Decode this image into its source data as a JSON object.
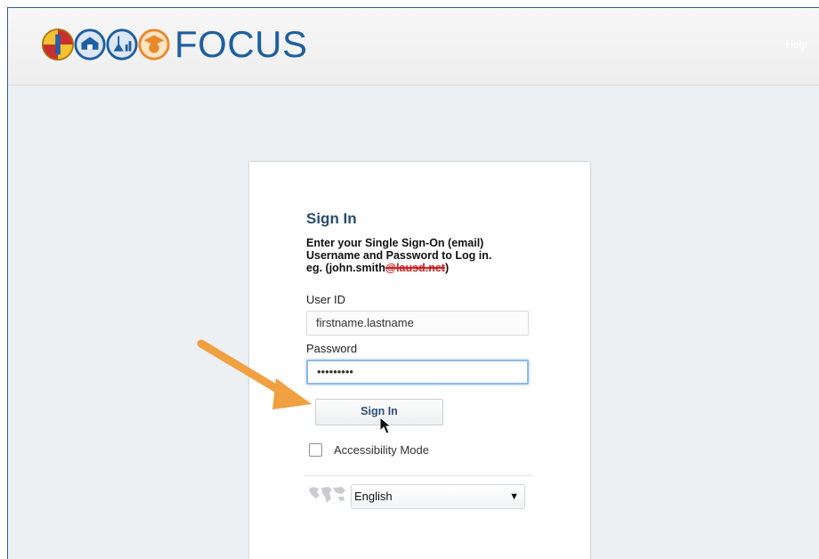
{
  "header": {
    "brand": "FOCUS",
    "help_label": "Help",
    "logo_icons": [
      "lausd-seal-icon",
      "school-building-icon",
      "lab-icon",
      "graduate-icon"
    ]
  },
  "login": {
    "title": "Sign In",
    "instructions_line1": "Enter your Single Sign-On (email)",
    "instructions_line2": "Username and Password to Log in.",
    "instructions_prefix": "eg. (john.smith",
    "instructions_struck": "@lausd.net",
    "instructions_suffix": ")",
    "user_id_label": "User ID",
    "user_id_value": "firstname.lastname",
    "password_label": "Password",
    "password_value": "•••••••••",
    "signin_button": "Sign In",
    "accessibility_label": "Accessibility Mode",
    "language_selected": "English",
    "select_caret": "▼"
  },
  "colors": {
    "brand_blue": "#1f5f9f",
    "annotation_arrow": "#f0a040",
    "strike_red": "#d11f1f"
  }
}
